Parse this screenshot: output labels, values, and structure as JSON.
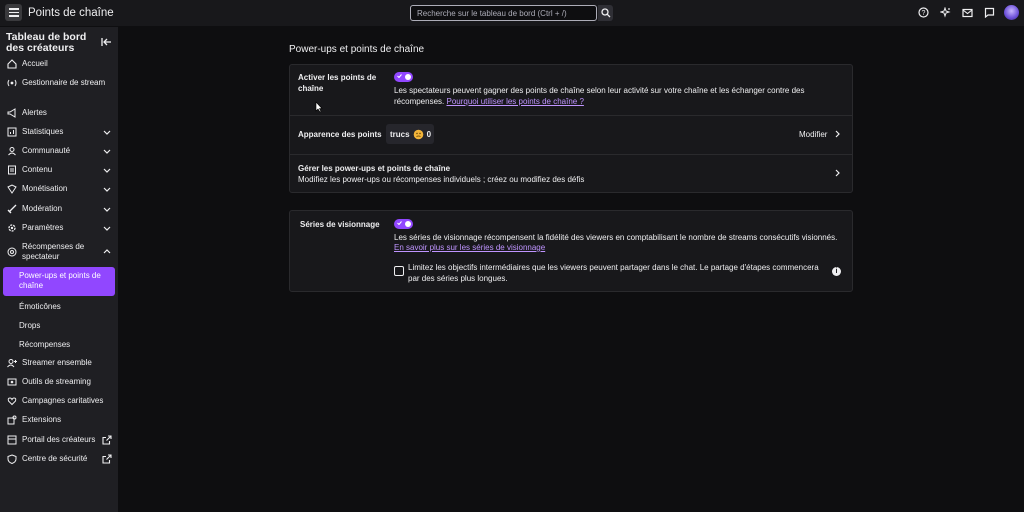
{
  "topbar": {
    "title": "Points de chaîne",
    "search_placeholder": "Recherche sur le tableau de bord (Ctrl + /)",
    "icons": [
      "help-icon",
      "sparkle-icon",
      "mail-icon",
      "whisper-icon",
      "avatar"
    ]
  },
  "sidebar": {
    "title": "Tableau de bord des créateurs",
    "items": [
      {
        "label": "Accueil",
        "icon": "home-icon",
        "expandable": false
      },
      {
        "label": "Gestionnaire de stream",
        "icon": "stream-manager-icon",
        "expandable": false
      },
      {
        "label": "Alertes",
        "icon": "megaphone-icon",
        "expandable": false
      },
      {
        "label": "Statistiques",
        "icon": "chart-icon",
        "expandable": true
      },
      {
        "label": "Communauté",
        "icon": "community-icon",
        "expandable": true
      },
      {
        "label": "Contenu",
        "icon": "content-icon",
        "expandable": true
      },
      {
        "label": "Monétisation",
        "icon": "money-icon",
        "expandable": true
      },
      {
        "label": "Modération",
        "icon": "sword-icon",
        "expandable": true
      },
      {
        "label": "Paramètres",
        "icon": "gear-icon",
        "expandable": true
      },
      {
        "label": "Récompenses de spectateur",
        "icon": "rewards-icon",
        "expandable": true,
        "expanded": true
      }
    ],
    "subitems": [
      {
        "label": "Power-ups et points de chaîne",
        "active": true
      },
      {
        "label": "Émoticônes",
        "active": false
      },
      {
        "label": "Drops",
        "active": false
      },
      {
        "label": "Récompenses",
        "active": false
      }
    ],
    "items_after": [
      {
        "label": "Streamer ensemble",
        "icon": "add-user-icon",
        "external": false
      },
      {
        "label": "Outils de streaming",
        "icon": "broadcast-icon",
        "external": false
      },
      {
        "label": "Campagnes caritatives",
        "icon": "charity-icon",
        "external": false
      },
      {
        "label": "Extensions",
        "icon": "extensions-icon",
        "external": false
      },
      {
        "label": "Portail des créateurs",
        "icon": "portal-icon",
        "external": true
      },
      {
        "label": "Centre de sécurité",
        "icon": "shield-icon",
        "external": true
      }
    ]
  },
  "main": {
    "title": "Power-ups et points de chaîne",
    "points_card": {
      "enable_label": "Activer les points de chaîne",
      "enable_on": true,
      "enable_desc": "Les spectateurs peuvent gagner des points de chaîne selon leur activité sur votre chaîne et les échanger contre des récompenses.",
      "enable_link": "Pourquoi utiliser les points de chaîne ?",
      "appearance_label": "Apparence des points",
      "points_name": "trucs",
      "points_value": "0",
      "modify_label": "Modifier",
      "manage_title": "Gérer les power-ups et points de chaîne",
      "manage_desc": "Modifiez les power-ups ou récompenses individuels ; créez ou modifiez des défis"
    },
    "streak_card": {
      "label": "Séries de visionnage",
      "enabled": true,
      "desc": "Les séries de visionnage récompensent la fidélité des viewers en comptabilisant le nombre de streams consécutifs visionnés.",
      "link": "En savoir plus sur les séries de visionnage",
      "checkbox_label": "Limitez les objectifs intermédiaires que les viewers peuvent partager dans le chat. Le partage d'étapes commencera par des séries plus longues.",
      "checkbox_checked": false
    }
  },
  "colors": {
    "accent": "#9147ff",
    "link": "#bf94ff",
    "background": "#0e0e10",
    "card": "#18181b"
  }
}
